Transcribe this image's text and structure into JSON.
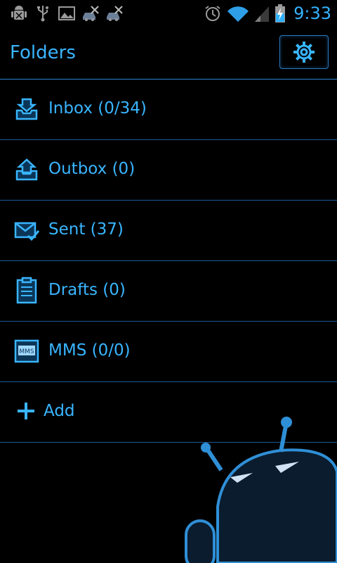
{
  "status_bar": {
    "time": "9:33",
    "icons": [
      "android-debug-icon",
      "usb-icon",
      "picture-icon",
      "car-tools-icon",
      "car-tools-icon",
      "alarm-icon",
      "wifi-icon",
      "signal-icon",
      "battery-charging-icon"
    ]
  },
  "header": {
    "title": "Folders",
    "settings_icon": "gear-icon"
  },
  "folders": [
    {
      "label": "Inbox (0/34)",
      "icon": "inbox-icon"
    },
    {
      "label": "Outbox (0)",
      "icon": "outbox-icon"
    },
    {
      "label": "Sent (37)",
      "icon": "sent-icon"
    },
    {
      "label": "Drafts (0)",
      "icon": "drafts-icon"
    },
    {
      "label": "MMS (0/0)",
      "icon": "mms-icon"
    }
  ],
  "add": {
    "label": "Add",
    "icon": "plus-icon"
  },
  "mms_icon_text": "MMS",
  "colors": {
    "background": "#000000",
    "accent": "#39b5ff",
    "divider": "#1d5a96"
  }
}
